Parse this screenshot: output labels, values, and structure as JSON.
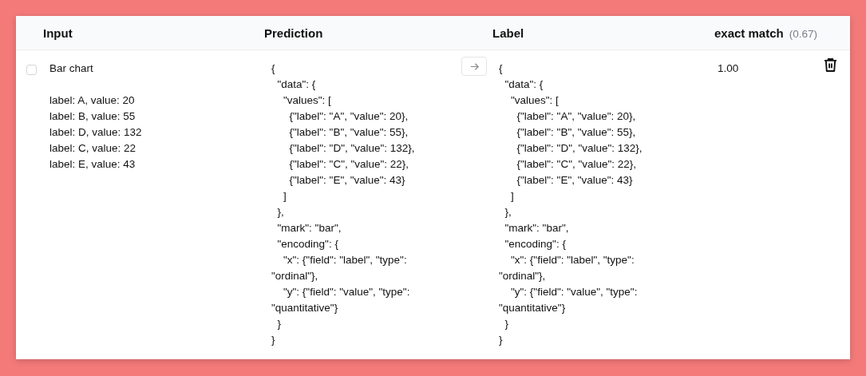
{
  "table": {
    "columns": [
      {
        "label": "Input"
      },
      {
        "label": "Prediction"
      },
      {
        "label": "Label"
      },
      {
        "label": "exact match",
        "metric": "(0.67)"
      }
    ],
    "rows": [
      {
        "selected": false,
        "input_title": "Bar chart",
        "input_lines": [
          "label: A, value: 20",
          "label: B, value: 55",
          "label: D, value: 132",
          "label: C, value: 22",
          "label: E, value: 43"
        ],
        "prediction": [
          "{",
          "  \"data\": {",
          "    \"values\": [",
          "      {\"label\": \"A\", \"value\": 20},",
          "      {\"label\": \"B\", \"value\": 55},",
          "      {\"label\": \"D\", \"value\": 132},",
          "      {\"label\": \"C\", \"value\": 22},",
          "      {\"label\": \"E\", \"value\": 43}",
          "    ]",
          "  },",
          "  \"mark\": \"bar\",",
          "  \"encoding\": {",
          "    \"x\": {\"field\": \"label\", \"type\":",
          "\"ordinal\"},",
          "    \"y\": {\"field\": \"value\", \"type\":",
          "\"quantitative\"}",
          "  }",
          "}"
        ],
        "label": [
          "{",
          "  \"data\": {",
          "    \"values\": [",
          "      {\"label\": \"A\", \"value\": 20},",
          "      {\"label\": \"B\", \"value\": 55},",
          "      {\"label\": \"D\", \"value\": 132},",
          "      {\"label\": \"C\", \"value\": 22},",
          "      {\"label\": \"E\", \"value\": 43}",
          "    ]",
          "  },",
          "  \"mark\": \"bar\",",
          "  \"encoding\": {",
          "    \"x\": {\"field\": \"label\", \"type\":",
          "\"ordinal\"},",
          "    \"y\": {\"field\": \"value\", \"type\":",
          "\"quantitative\"}",
          "  }",
          "}"
        ],
        "score": "1.00"
      }
    ]
  }
}
